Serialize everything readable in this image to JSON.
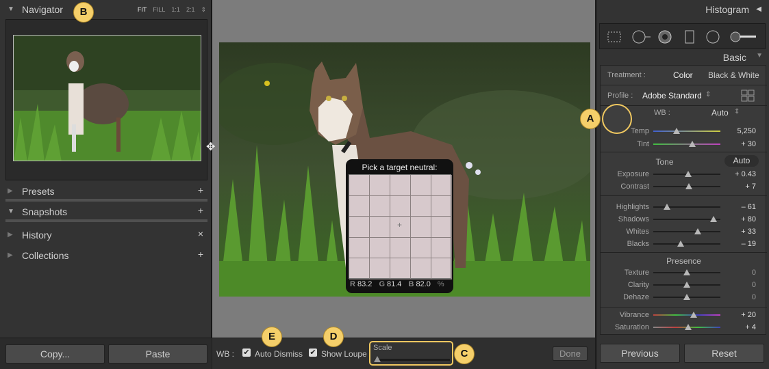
{
  "left_panel": {
    "navigator": {
      "title": "Navigator",
      "zoom": [
        "FIT",
        "FILL",
        "1:1",
        "2:1"
      ],
      "zoom_arrow": "⇕"
    },
    "presets": {
      "title": "Presets",
      "action": "+"
    },
    "snapshots": {
      "title": "Snapshots",
      "action": "+"
    },
    "history": {
      "title": "History",
      "action": "×"
    },
    "collections": {
      "title": "Collections",
      "action": "+"
    },
    "copy_label": "Copy...",
    "paste_label": "Paste"
  },
  "loupe": {
    "title": "Pick a target neutral:",
    "r_label": "R",
    "r_value": "83.2",
    "g_label": "G",
    "g_value": "81.4",
    "b_label": "B",
    "b_value": "82.0",
    "unit": "%"
  },
  "toolbar": {
    "wb_label": "WB :",
    "auto_dismiss": "Auto Dismiss",
    "show_loupe": "Show Loupe",
    "scale_label": "Scale",
    "done_label": "Done"
  },
  "right_panel": {
    "histogram_title": "Histogram",
    "basic_title": "Basic",
    "treatment_label": "Treatment :",
    "treatment_color": "Color",
    "treatment_bw": "Black & White",
    "profile_label": "Profile :",
    "profile_value": "Adobe Standard",
    "wb_label": "WB :",
    "wb_value": "Auto",
    "tone_label": "Tone",
    "tone_auto": "Auto",
    "presence_label": "Presence",
    "sliders": [
      {
        "label": "Temp",
        "value": "5,250",
        "pos": 0.35
      },
      {
        "label": "Tint",
        "value": "+ 30",
        "pos": 0.58
      },
      {
        "label": "Exposure",
        "value": "+ 0.43",
        "pos": 0.52
      },
      {
        "label": "Contrast",
        "value": "+ 7",
        "pos": 0.53
      },
      {
        "label": "Highlights",
        "value": "– 61",
        "pos": 0.2
      },
      {
        "label": "Shadows",
        "value": "+ 80",
        "pos": 0.9
      },
      {
        "label": "Whites",
        "value": "+ 33",
        "pos": 0.66
      },
      {
        "label": "Blacks",
        "value": "– 19",
        "pos": 0.41
      },
      {
        "label": "Texture",
        "value": "0",
        "pos": 0.5
      },
      {
        "label": "Clarity",
        "value": "0",
        "pos": 0.5
      },
      {
        "label": "Dehaze",
        "value": "0",
        "pos": 0.5
      },
      {
        "label": "Vibrance",
        "value": "+ 20",
        "pos": 0.6
      },
      {
        "label": "Saturation",
        "value": "+ 4",
        "pos": 0.52
      }
    ],
    "previous_label": "Previous",
    "reset_label": "Reset"
  },
  "callouts": {
    "a": "A",
    "b": "B",
    "c": "C",
    "d": "D",
    "e": "E"
  },
  "colors": {
    "callout": "#f5cf6a",
    "panel": "#333333",
    "canvas": "#7c7c7c"
  }
}
